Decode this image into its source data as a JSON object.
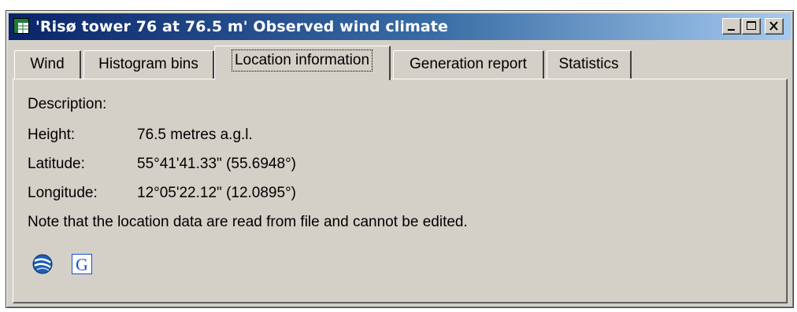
{
  "window": {
    "title": "'Risø tower 76 at 76.5 m' Observed wind climate",
    "icon": "table-icon",
    "controls": {
      "minimize": "minimize-icon",
      "maximize": "maximize-icon",
      "close": "close-icon"
    }
  },
  "tabs": [
    {
      "label": "Wind"
    },
    {
      "label": "Histogram bins"
    },
    {
      "label": "Location information",
      "active": true
    },
    {
      "label": "Generation report"
    },
    {
      "label": "Statistics"
    }
  ],
  "location": {
    "description_label": "Description:",
    "height_label": "Height:",
    "height_value": "76.5 metres a.g.l.",
    "latitude_label": "Latitude:",
    "latitude_value": "55°41'41.33\" (55.6948°)",
    "longitude_label": "Longitude:",
    "longitude_value": "12°05'22.12\" (12.0895°)",
    "note": "Note that the location data are read from file and cannot be edited."
  },
  "actions": {
    "globe_icon": "google-earth-icon",
    "maps_icon": "google-maps-icon",
    "maps_glyph": "G"
  },
  "colors": {
    "title_gradient_start": "#0a246a",
    "title_gradient_end": "#a6caf0",
    "window_face": "#d4d0c8",
    "google_g_blue": "#1a4fd8"
  }
}
